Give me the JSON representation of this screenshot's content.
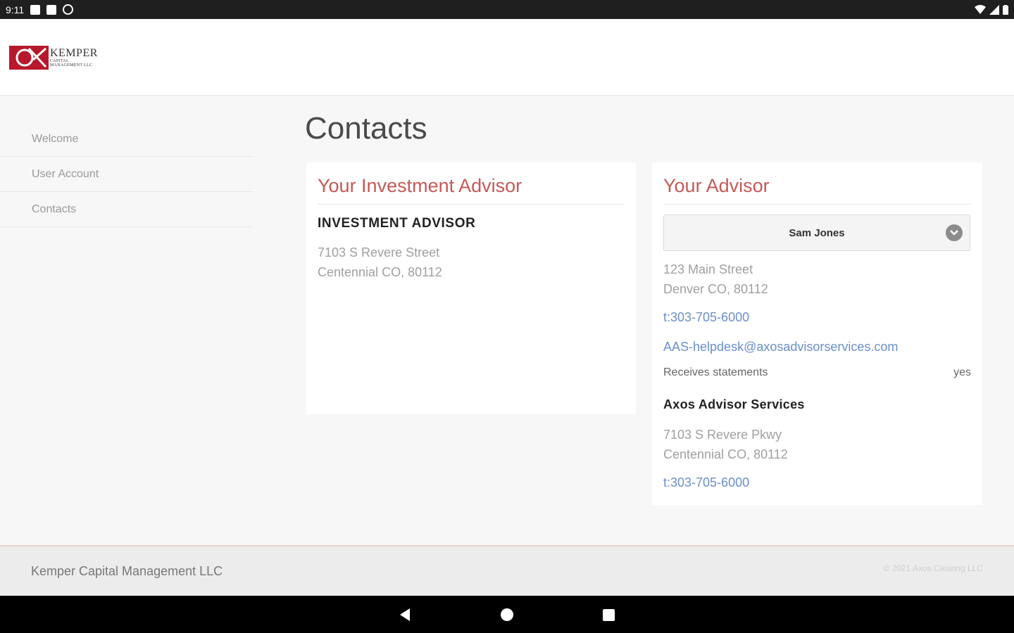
{
  "status_bar": {
    "time": "9:11",
    "icons": [
      "notification-icon",
      "sd-card-icon",
      "sync-icon",
      "wifi-icon",
      "signal-icon",
      "battery-icon"
    ]
  },
  "header": {
    "logo_text": "KEMPER",
    "logo_subtext_1": "CAPITAL",
    "logo_subtext_2": "MANAGEMENT LLC"
  },
  "sidebar": {
    "items": [
      {
        "label": "Welcome"
      },
      {
        "label": "User Account"
      },
      {
        "label": "Contacts"
      }
    ]
  },
  "page": {
    "title": "Contacts"
  },
  "investment_card": {
    "title": "Your Investment Advisor",
    "name": "INVESTMENT ADVISOR",
    "address_line1": "7103 S Revere Street",
    "address_line2": "Centennial CO, 80112"
  },
  "advisor_card": {
    "title": "Your Advisor",
    "selected_advisor": "Sam Jones",
    "address_line1": "123 Main Street",
    "address_line2": "Denver CO, 80112",
    "phone": "t:303-705-6000",
    "email": "AAS-helpdesk@axosadvisorservices.com",
    "statements_label": "Receives statements",
    "statements_value": "yes",
    "company_name": "Axos Advisor Services",
    "company_address_line1": "7103 S Revere Pkwy",
    "company_address_line2": "Centennial CO, 80112",
    "company_phone": "t:303-705-6000"
  },
  "footer": {
    "company": "Kemper Capital Management LLC",
    "copyright": "© 2021 Axos Clearing LLC"
  },
  "colors": {
    "accent": "#c45a57",
    "link": "#6a8fcc",
    "brand_red": "#b8182b"
  }
}
